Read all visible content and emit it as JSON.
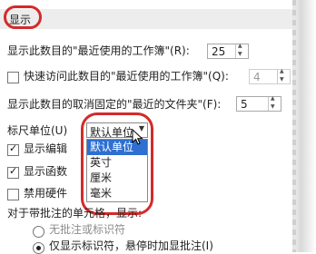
{
  "section": {
    "title": "显示"
  },
  "options": {
    "recent_workbooks": {
      "label": "显示此数目的\"最近使用的工作簿\"(R):",
      "value": "25"
    },
    "quick_access": {
      "label": "快速访问此数目的\"最近使用的工作簿\"(Q):",
      "value": "4",
      "checked": false
    },
    "unpinned_folders": {
      "label": "显示此数目的取消固定的\"最近的文件夹\"(F):",
      "value": "5"
    },
    "ruler_units": {
      "label": "标尺单位(U)",
      "selected": "默认单位",
      "options": [
        "默认单位",
        "英寸",
        "厘米",
        "毫米"
      ]
    },
    "show_edit": {
      "label": "显示编辑",
      "checked": true
    },
    "show_function": {
      "label": "显示函数",
      "checked": true
    },
    "disable_hardware": {
      "label": "禁用硬件",
      "checked": false
    },
    "comments_heading": "对于带批注的单元格，显示:",
    "no_comments": "无批注或标识符",
    "indicators_only": "仅显示标识符，悬停时加显批注(I)"
  },
  "colors": {
    "highlight_circle": "#d42a2a",
    "selection": "#2f6fd1"
  }
}
